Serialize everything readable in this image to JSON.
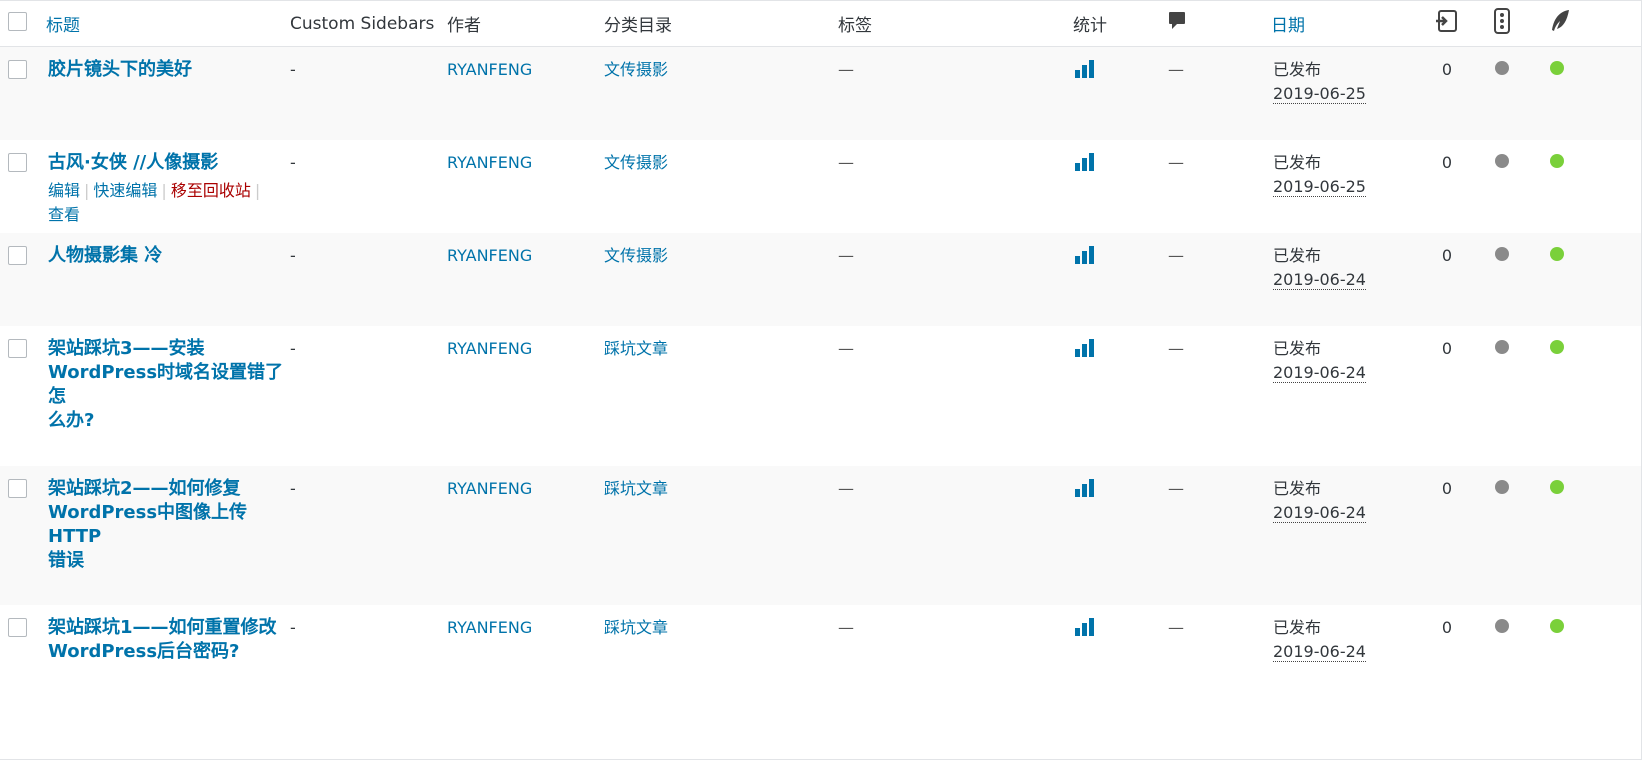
{
  "header": {
    "title_col": "标题",
    "sidebars_col": "Custom Sidebars",
    "author_col": "作者",
    "category_col": "分类目录",
    "tags_col": "标签",
    "stats_col": "统计",
    "date_col": "日期"
  },
  "row_actions": {
    "edit": "编辑",
    "quick_edit": "快速编辑",
    "trash": "移至回收站",
    "view": "查看",
    "sep": "|"
  },
  "rows": [
    {
      "title_lines": [
        "胶片镜头下的美好"
      ],
      "sidebars": "-",
      "author": "RYANFENG",
      "category": "文传摄影",
      "tags": "—",
      "comments": "—",
      "status": "已发布",
      "date": "2019-06-25",
      "count": "0"
    },
    {
      "title_lines": [
        "古风·女侠 //人像摄影"
      ],
      "sidebars": "-",
      "author": "RYANFENG",
      "category": "文传摄影",
      "tags": "—",
      "comments": "—",
      "status": "已发布",
      "date": "2019-06-25",
      "count": "0"
    },
    {
      "title_lines": [
        "人物摄影集 冷"
      ],
      "sidebars": "-",
      "author": "RYANFENG",
      "category": "文传摄影",
      "tags": "—",
      "comments": "—",
      "status": "已发布",
      "date": "2019-06-24",
      "count": "0"
    },
    {
      "title_lines": [
        "架站踩坑3——安装",
        "WordPress时域名设置错了怎",
        "么办?"
      ],
      "sidebars": "-",
      "author": "RYANFENG",
      "category": "踩坑文章",
      "tags": "—",
      "comments": "—",
      "status": "已发布",
      "date": "2019-06-24",
      "count": "0"
    },
    {
      "title_lines": [
        "架站踩坑2——如何修复",
        "WordPress中图像上传HTTP",
        "错误"
      ],
      "sidebars": "-",
      "author": "RYANFENG",
      "category": "踩坑文章",
      "tags": "—",
      "comments": "—",
      "status": "已发布",
      "date": "2019-06-24",
      "count": "0"
    },
    {
      "title_lines": [
        "架站踩坑1——如何重置修改",
        "WordPress后台密码?"
      ],
      "sidebars": "-",
      "author": "RYANFENG",
      "category": "踩坑文章",
      "tags": "—",
      "comments": "—",
      "status": "已发布",
      "date": "2019-06-24",
      "count": "0"
    }
  ],
  "colors": {
    "link": "#0073aa",
    "trash": "#a00",
    "dot_gray": "#8a8a8a",
    "dot_green": "#7ad03a"
  },
  "icons": {
    "comments": "comment-bubble-icon",
    "revisions": "revisions-icon",
    "traffic": "traffic-light-icon",
    "seo": "feather-icon",
    "stats": "bar-chart-icon"
  }
}
